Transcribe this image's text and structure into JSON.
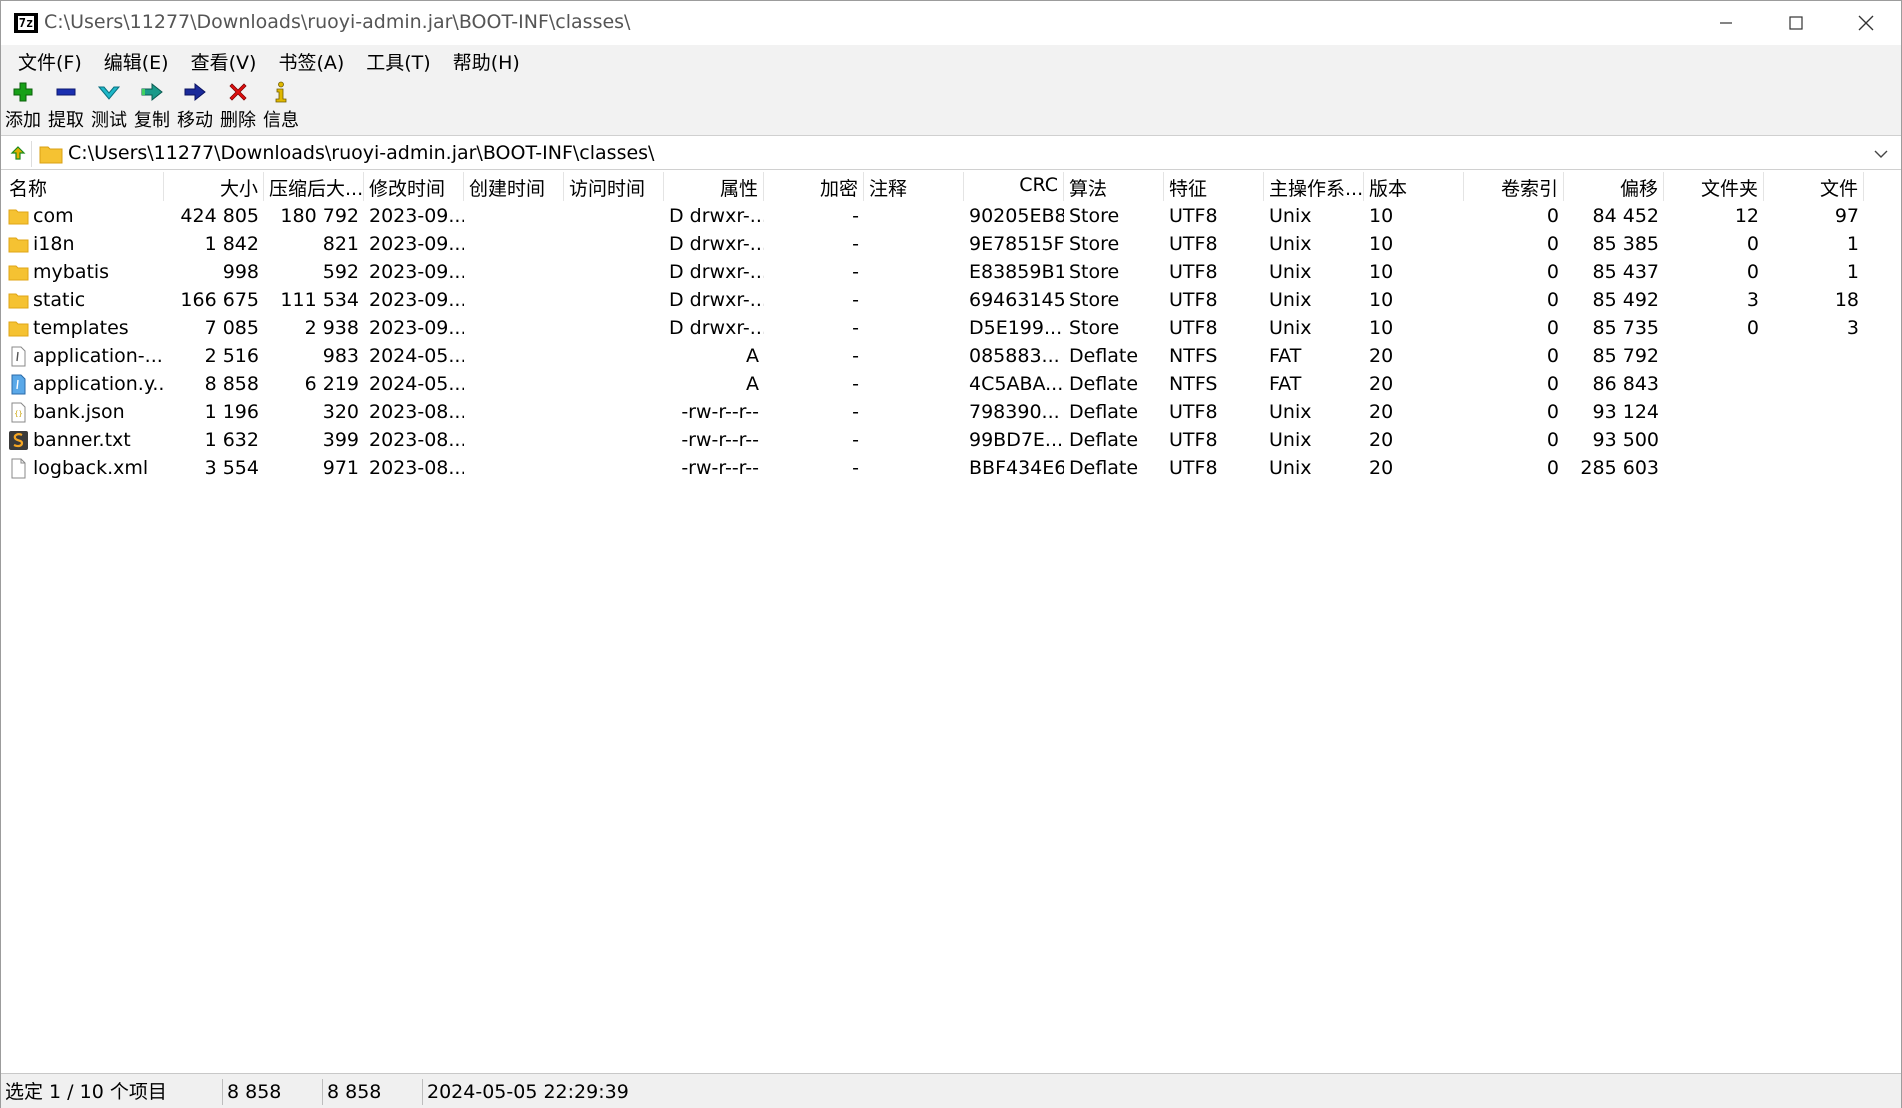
{
  "window": {
    "title": "C:\\Users\\11277\\Downloads\\ruoyi-admin.jar\\BOOT-INF\\classes\\",
    "icon_text": "7z"
  },
  "menu": [
    "文件(F)",
    "编辑(E)",
    "查看(V)",
    "书签(A)",
    "工具(T)",
    "帮助(H)"
  ],
  "toolbar": [
    {
      "label": "添加",
      "icon": "plus-icon",
      "color": "#18a018"
    },
    {
      "label": "提取",
      "icon": "minus-icon",
      "color": "#1a2fb0"
    },
    {
      "label": "测试",
      "icon": "check-icon",
      "color": "#1eb0c0"
    },
    {
      "label": "复制",
      "icon": "copy-arrow-icon",
      "color": "#1a9a8a"
    },
    {
      "label": "移动",
      "icon": "move-arrow-icon",
      "color": "#1a2a9a"
    },
    {
      "label": "删除",
      "icon": "delete-x-icon",
      "color": "#e01010"
    },
    {
      "label": "信息",
      "icon": "info-icon",
      "color": "#d4a800"
    }
  ],
  "address": {
    "path": "C:\\Users\\11277\\Downloads\\ruoyi-admin.jar\\BOOT-INF\\classes\\"
  },
  "columns": [
    "名称",
    "大小",
    "压缩后大...",
    "修改时间",
    "创建时间",
    "访问时间",
    "属性",
    "加密",
    "注释",
    "CRC",
    "算法",
    "特征",
    "主操作系...",
    "版本",
    "卷索引",
    "偏移",
    "文件夹",
    "文件"
  ],
  "rows": [
    {
      "icon": "folder",
      "name": "com",
      "size": "424 805",
      "packed": "180 792",
      "modified": "2023-09...",
      "created": "",
      "accessed": "",
      "attr": "D drwxr-...",
      "enc": "-",
      "comment": "",
      "crc": "90205EB8",
      "method": "Store",
      "char": "UTF8",
      "os": "Unix",
      "ver": "10",
      "vol": "0",
      "offset": "84 452",
      "folders": "12",
      "files": "97"
    },
    {
      "icon": "folder",
      "name": "i18n",
      "size": "1 842",
      "packed": "821",
      "modified": "2023-09...",
      "created": "",
      "accessed": "",
      "attr": "D drwxr-...",
      "enc": "-",
      "comment": "",
      "crc": "9E78515F",
      "method": "Store",
      "char": "UTF8",
      "os": "Unix",
      "ver": "10",
      "vol": "0",
      "offset": "85 385",
      "folders": "0",
      "files": "1"
    },
    {
      "icon": "folder",
      "name": "mybatis",
      "size": "998",
      "packed": "592",
      "modified": "2023-09...",
      "created": "",
      "accessed": "",
      "attr": "D drwxr-...",
      "enc": "-",
      "comment": "",
      "crc": "E83859B1",
      "method": "Store",
      "char": "UTF8",
      "os": "Unix",
      "ver": "10",
      "vol": "0",
      "offset": "85 437",
      "folders": "0",
      "files": "1"
    },
    {
      "icon": "folder",
      "name": "static",
      "size": "166 675",
      "packed": "111 534",
      "modified": "2023-09...",
      "created": "",
      "accessed": "",
      "attr": "D drwxr-...",
      "enc": "-",
      "comment": "",
      "crc": "69463145",
      "method": "Store",
      "char": "UTF8",
      "os": "Unix",
      "ver": "10",
      "vol": "0",
      "offset": "85 492",
      "folders": "3",
      "files": "18"
    },
    {
      "icon": "folder",
      "name": "templates",
      "size": "7 085",
      "packed": "2 938",
      "modified": "2023-09...",
      "created": "",
      "accessed": "",
      "attr": "D drwxr-...",
      "enc": "-",
      "comment": "",
      "crc": "D5E199...",
      "method": "Store",
      "char": "UTF8",
      "os": "Unix",
      "ver": "10",
      "vol": "0",
      "offset": "85 735",
      "folders": "0",
      "files": "3"
    },
    {
      "icon": "config-file",
      "name": "application-...",
      "size": "2 516",
      "packed": "983",
      "modified": "2024-05...",
      "created": "",
      "accessed": "",
      "attr": "A",
      "enc": "-",
      "comment": "",
      "crc": "085883...",
      "method": "Deflate",
      "char": "NTFS",
      "os": "FAT",
      "ver": "20",
      "vol": "0",
      "offset": "85 792",
      "folders": "",
      "files": ""
    },
    {
      "icon": "config-file-blue",
      "name": "application.y...",
      "size": "8 858",
      "packed": "6 219",
      "modified": "2024-05...",
      "created": "",
      "accessed": "",
      "attr": "A",
      "enc": "-",
      "comment": "",
      "crc": "4C5ABA...",
      "method": "Deflate",
      "char": "NTFS",
      "os": "FAT",
      "ver": "20",
      "vol": "0",
      "offset": "86 843",
      "folders": "",
      "files": ""
    },
    {
      "icon": "json-file",
      "name": "bank.json",
      "size": "1 196",
      "packed": "320",
      "modified": "2023-08...",
      "created": "",
      "accessed": "",
      "attr": "-rw-r--r--",
      "enc": "-",
      "comment": "",
      "crc": "798390...",
      "method": "Deflate",
      "char": "UTF8",
      "os": "Unix",
      "ver": "20",
      "vol": "0",
      "offset": "93 124",
      "folders": "",
      "files": ""
    },
    {
      "icon": "text-file-orange",
      "name": "banner.txt",
      "size": "1 632",
      "packed": "399",
      "modified": "2023-08...",
      "created": "",
      "accessed": "",
      "attr": "-rw-r--r--",
      "enc": "-",
      "comment": "",
      "crc": "99BD7E...",
      "method": "Deflate",
      "char": "UTF8",
      "os": "Unix",
      "ver": "20",
      "vol": "0",
      "offset": "93 500",
      "folders": "",
      "files": ""
    },
    {
      "icon": "blank-file",
      "name": "logback.xml",
      "size": "3 554",
      "packed": "971",
      "modified": "2023-08...",
      "created": "",
      "accessed": "",
      "attr": "-rw-r--r--",
      "enc": "-",
      "comment": "",
      "crc": "BBF434E6",
      "method": "Deflate",
      "char": "UTF8",
      "os": "Unix",
      "ver": "20",
      "vol": "0",
      "offset": "285 603",
      "folders": "",
      "files": ""
    }
  ],
  "status": {
    "selection": "选定 1 / 10 个项目",
    "size": "8 858",
    "packed": "8 858",
    "datetime": "2024-05-05 22:29:39"
  },
  "colors": {
    "folder": "#f5c232",
    "folder_dark": "#e0a516",
    "toolbar_bg": "#f2f2f2"
  }
}
